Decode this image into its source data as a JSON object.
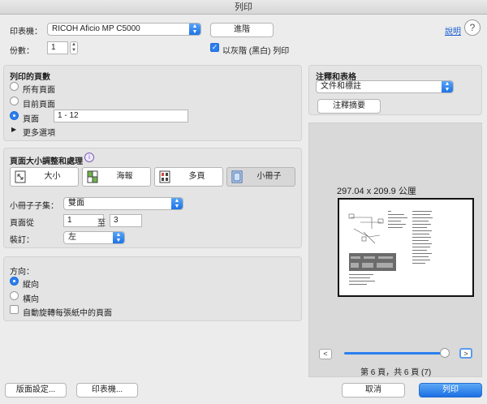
{
  "window": {
    "title": "列印"
  },
  "printer": {
    "label": "印表機：",
    "value": "RICOH Aficio MP C5000",
    "advanced_button": "進階",
    "help_link": "說明"
  },
  "copies": {
    "label": "份數：",
    "value": "1",
    "grayscale_label": "以灰階 (黑白) 列印",
    "grayscale_checked": true
  },
  "pages_section": {
    "title": "列印的頁數",
    "options": [
      "所有頁面",
      "目前頁面",
      "頁面"
    ],
    "selected": "頁面",
    "range_value": "1 - 12",
    "more_options": "更多選項"
  },
  "layout_section": {
    "title": "頁面大小調整和處理",
    "modes": [
      "大小",
      "海報",
      "多頁",
      "小冊子"
    ],
    "selected_mode": "小冊子",
    "booklet_subset_label": "小冊子子集：",
    "booklet_subset_value": "雙面",
    "pages_from_label": "頁面從",
    "pages_from": "1",
    "pages_to_label": "至",
    "pages_to": "3",
    "binding_label": "裝訂：",
    "binding_value": "左"
  },
  "orientation_section": {
    "title": "方向：",
    "options": [
      "縱向",
      "橫向"
    ],
    "selected": "縱向",
    "auto_rotate_label": "自動旋轉每張紙中的頁面",
    "auto_rotate_checked": false
  },
  "comments": {
    "title": "注釋和表格",
    "value": "文件和標註",
    "summary_button": "注釋摘要"
  },
  "preview": {
    "paper_size": "297.04 x 209.9 公厘",
    "page_indicator": "第 6 頁，共 6 頁 (7)",
    "prev_button": "<",
    "next_button": ">",
    "slider_position": 1.0
  },
  "footer": {
    "page_setup": "版面設定...",
    "printer_button": "印表機...",
    "cancel": "取消",
    "print": "列印"
  },
  "colors": {
    "accent": "#2a7ff0",
    "primary_button": "#1b6fe3"
  }
}
